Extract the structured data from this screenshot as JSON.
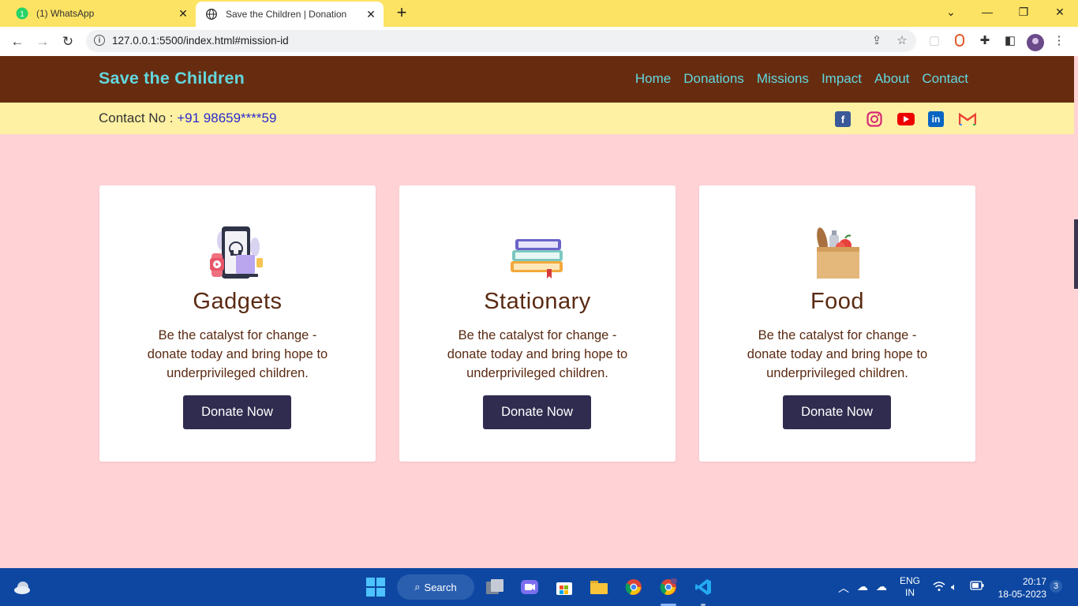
{
  "browser": {
    "tabs": [
      {
        "title": "(1) WhatsApp",
        "badge": "1",
        "active": false
      },
      {
        "title": "Save the Children | Donation",
        "active": true
      }
    ],
    "url": "127.0.0.1:5500/index.html#mission-id"
  },
  "site": {
    "brand": "Save the Children",
    "nav": [
      "Home",
      "Donations",
      "Missions",
      "Impact",
      "About",
      "Contact"
    ],
    "contact_label": "Contact No : ",
    "contact_phone": "+91 98659****59",
    "social_icons": [
      "facebook-icon",
      "instagram-icon",
      "youtube-icon",
      "linkedin-icon",
      "gmail-icon"
    ]
  },
  "cards": [
    {
      "title": "Gadgets",
      "text": "Be the catalyst for change - donate today and bring hope to underprivileged children.",
      "button": "Donate Now",
      "icon": "gadgets-icon"
    },
    {
      "title": "Stationary",
      "text": "Be the catalyst for change - donate today and bring hope to underprivileged children.",
      "button": "Donate Now",
      "icon": "books-icon"
    },
    {
      "title": "Food",
      "text": "Be the catalyst for change - donate today and bring hope to underprivileged children.",
      "button": "Donate Now",
      "icon": "grocery-bag-icon"
    }
  ],
  "taskbar": {
    "search_label": "Search",
    "lang_top": "ENG",
    "lang_bottom": "IN",
    "time": "20:17",
    "date": "18-05-2023",
    "notification_count": "3"
  },
  "colors": {
    "header_bg": "#672c10",
    "accent": "#62d7de",
    "contact_bg": "#fff1a3",
    "page_bg": "#ffd3d6",
    "button_bg": "#2f2c4f"
  }
}
